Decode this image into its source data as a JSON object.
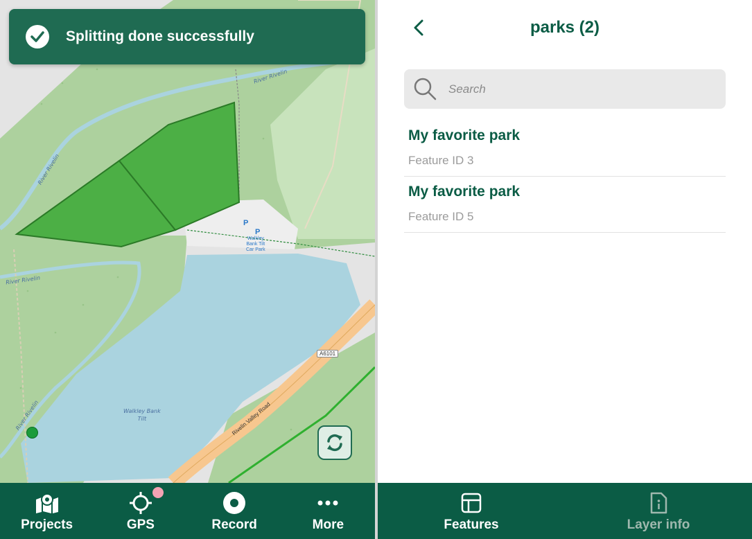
{
  "toast": {
    "message": "Splitting done successfully",
    "icon": "check-circle-icon"
  },
  "map": {
    "labels": {
      "river_1": "River Rivelin",
      "river_2": "River Rivelin",
      "river_3": "River Rivelin",
      "river_4": "River Rivelin",
      "reservoir": "Walkley Bank\nTilt",
      "road": "Rivelin Valley Road",
      "road_shield": "A6101",
      "car_park": "Walkley\nBank Tilt\nCar Park",
      "parking_1": "P",
      "parking_2": "P"
    }
  },
  "bottom_nav": {
    "items": [
      {
        "label": "Projects",
        "icon": "map-pin-icon"
      },
      {
        "label": "GPS",
        "icon": "crosshair-icon"
      },
      {
        "label": "Record",
        "icon": "record-icon"
      },
      {
        "label": "More",
        "icon": "more-dots-icon"
      }
    ]
  },
  "features_panel": {
    "title": "parks (2)",
    "search_placeholder": "Search",
    "features": [
      {
        "title": "My favorite park",
        "subtitle": "Feature ID 3"
      },
      {
        "title": "My favorite park",
        "subtitle": "Feature ID 5"
      }
    ],
    "tabs": [
      {
        "label": "Features",
        "icon": "table-icon",
        "active": true
      },
      {
        "label": "Layer info",
        "icon": "info-document-icon",
        "active": false
      }
    ]
  },
  "colors": {
    "brand": "#0b5c45",
    "polygon_fill": "#4caf45",
    "water": "#aad3df",
    "inactive_tab": "#9fb8ae",
    "gps_badge": "#f4a3b4"
  }
}
